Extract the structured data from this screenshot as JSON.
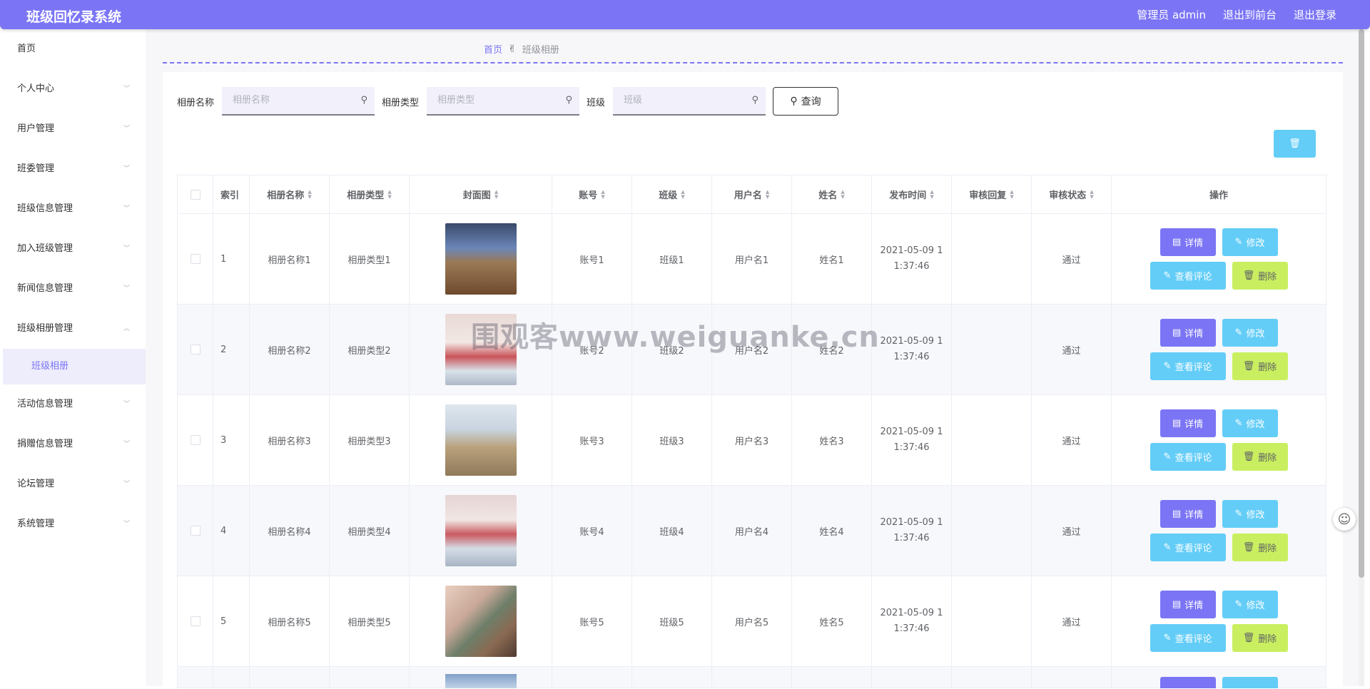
{
  "app": {
    "title": "班级回忆录系统"
  },
  "topbar": {
    "user": "管理员 admin",
    "to_front": "退出到前台",
    "logout": "退出登录"
  },
  "sidebar": {
    "items": [
      {
        "label": "首页",
        "has_children": false
      },
      {
        "label": "个人中心",
        "has_children": true
      },
      {
        "label": "用户管理",
        "has_children": true
      },
      {
        "label": "班委管理",
        "has_children": true
      },
      {
        "label": "班级信息管理",
        "has_children": true
      },
      {
        "label": "加入班级管理",
        "has_children": true
      },
      {
        "label": "新闻信息管理",
        "has_children": true
      },
      {
        "label": "班级相册管理",
        "has_children": true,
        "expanded": true
      },
      {
        "label": "活动信息管理",
        "has_children": true
      },
      {
        "label": "捐赠信息管理",
        "has_children": true
      },
      {
        "label": "论坛管理",
        "has_children": true
      },
      {
        "label": "系统管理",
        "has_children": true
      }
    ],
    "subitem": "班级相册"
  },
  "breadcrumb": {
    "home": "首页",
    "current": "班级相册"
  },
  "filters": {
    "album_name_label": "相册名称",
    "album_name_placeholder": "相册名称",
    "album_type_label": "相册类型",
    "album_type_placeholder": "相册类型",
    "class_label": "班级",
    "class_placeholder": "班级",
    "query_button": "查询"
  },
  "table": {
    "headers": [
      "索引",
      "相册名称",
      "相册类型",
      "封面图",
      "账号",
      "班级",
      "用户名",
      "姓名",
      "发布时间",
      "审核回复",
      "审核状态",
      "操作"
    ],
    "rows": [
      {
        "index": "1",
        "name": "相册名称1",
        "type": "相册类型1",
        "account": "账号1",
        "class": "班级1",
        "username": "用户名1",
        "realname": "姓名1",
        "time_line1": "2021-05-09 1",
        "time_line2": "1:37:46",
        "reply": "",
        "status": "通过"
      },
      {
        "index": "2",
        "name": "相册名称2",
        "type": "相册类型2",
        "account": "账号2",
        "class": "班级2",
        "username": "用户名2",
        "realname": "姓名2",
        "time_line1": "2021-05-09 1",
        "time_line2": "1:37:46",
        "reply": "",
        "status": "通过"
      },
      {
        "index": "3",
        "name": "相册名称3",
        "type": "相册类型3",
        "account": "账号3",
        "class": "班级3",
        "username": "用户名3",
        "realname": "姓名3",
        "time_line1": "2021-05-09 1",
        "time_line2": "1:37:46",
        "reply": "",
        "status": "通过"
      },
      {
        "index": "4",
        "name": "相册名称4",
        "type": "相册类型4",
        "account": "账号4",
        "class": "班级4",
        "username": "用户名4",
        "realname": "姓名4",
        "time_line1": "2021-05-09 1",
        "time_line2": "1:37:46",
        "reply": "",
        "status": "通过"
      },
      {
        "index": "5",
        "name": "相册名称5",
        "type": "相册类型5",
        "account": "账号5",
        "class": "班级5",
        "username": "用户名5",
        "realname": "姓名5",
        "time_line1": "2021-05-09 1",
        "time_line2": "1:37:46",
        "reply": "",
        "status": "通过"
      }
    ],
    "actions": {
      "detail": "详情",
      "edit": "修改",
      "comments": "查看评论",
      "delete": "删除"
    }
  },
  "watermark": "围观客www.weiguanke.cn",
  "colors": {
    "primary": "#7b75f5",
    "info": "#63cdf7",
    "lime": "#c9ef60"
  },
  "icons": [
    "search-icon",
    "trash-icon",
    "doc-icon",
    "edit-icon",
    "hand-icon",
    "chevron-down-icon",
    "chevron-up-icon"
  ]
}
